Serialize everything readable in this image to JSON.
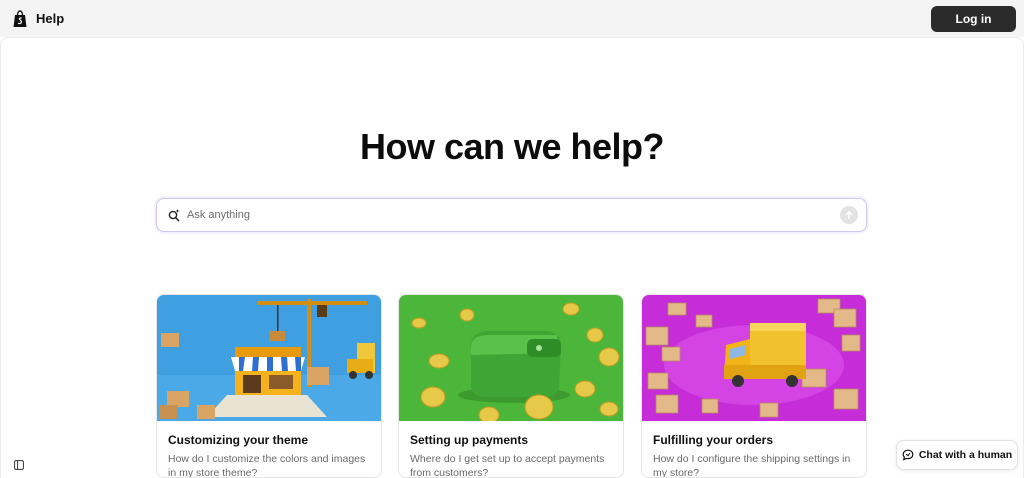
{
  "header": {
    "brand": "Help",
    "login_label": "Log in"
  },
  "hero": {
    "title": "How can we help?"
  },
  "search": {
    "placeholder": "Ask anything"
  },
  "cards": [
    {
      "title": "Customizing your theme",
      "description": "How do I customize the colors and images in my store theme?",
      "image": "storefront-construction-illustration"
    },
    {
      "title": "Setting up payments",
      "description": "Where do I get set up to accept payments from customers?",
      "image": "wallet-coins-illustration"
    },
    {
      "title": "Fulfilling your orders",
      "description": "How do I configure the shipping settings in my store?",
      "image": "delivery-truck-boxes-illustration"
    }
  ],
  "chat": {
    "label": "Chat with a human"
  },
  "colors": {
    "topbar": "#f4f4f5",
    "login_button": "#2b2b2b",
    "search_border": "#cfc5f1",
    "card1_bg": "#3f9fe0",
    "card2_bg": "#4cb63a",
    "card3_bg": "#c62dd8"
  }
}
